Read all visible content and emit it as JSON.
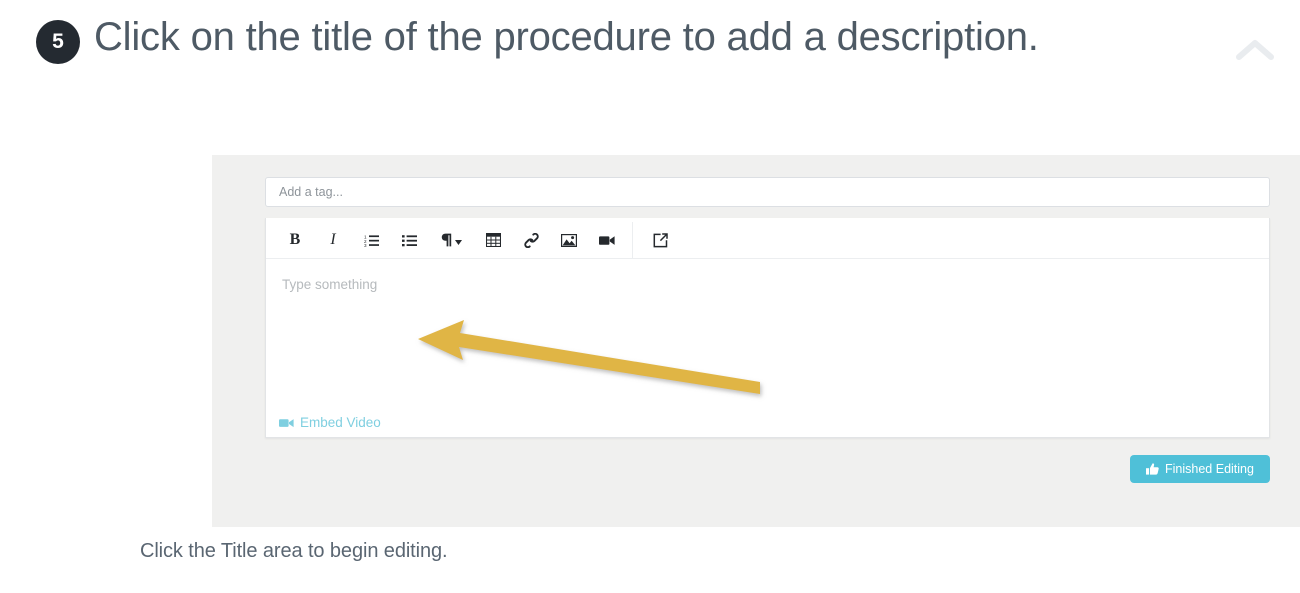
{
  "step": {
    "number": "5",
    "title": "Click on the title of the procedure to add a description.",
    "collapse_icon": "chevron-up-icon"
  },
  "screenshot": {
    "tag_input": {
      "placeholder": "Add a tag...",
      "value": ""
    },
    "toolbar": [
      {
        "name": "bold",
        "label": "B",
        "icon": "bold-icon"
      },
      {
        "name": "italic",
        "label": "I",
        "icon": "italic-icon"
      },
      {
        "name": "ordered-list",
        "label": "",
        "icon": "ordered-list-icon"
      },
      {
        "name": "unordered-list",
        "label": "",
        "icon": "unordered-list-icon"
      },
      {
        "name": "paragraph-format",
        "label": "",
        "icon": "pilcrow-dropdown-icon"
      },
      {
        "name": "table",
        "label": "",
        "icon": "table-icon"
      },
      {
        "name": "link",
        "label": "",
        "icon": "link-icon"
      },
      {
        "name": "image",
        "label": "",
        "icon": "image-icon"
      },
      {
        "name": "video",
        "label": "",
        "icon": "video-camera-icon"
      },
      {
        "name": "fullscreen",
        "label": "",
        "icon": "external-link-icon"
      }
    ],
    "editor": {
      "placeholder": "Type something",
      "value": ""
    },
    "embed_video": {
      "label": "Embed Video",
      "icon": "video-camera-icon"
    },
    "finished_editing": {
      "label": "Finished Editing",
      "icon": "thumbs-up-icon"
    }
  },
  "annotation": {
    "type": "arrow",
    "color": "#e0b544",
    "points_to": "editor body"
  },
  "caption": "Click the Title area to begin editing.",
  "colors": {
    "badge_bg": "#242a31",
    "heading_text": "#4e5a65",
    "panel_bg": "#f0f0ef",
    "accent_teal": "#4fc0d8",
    "link_teal": "#7fcfe0",
    "arrow_gold": "#e0b544",
    "caption_text": "#5a6672"
  }
}
